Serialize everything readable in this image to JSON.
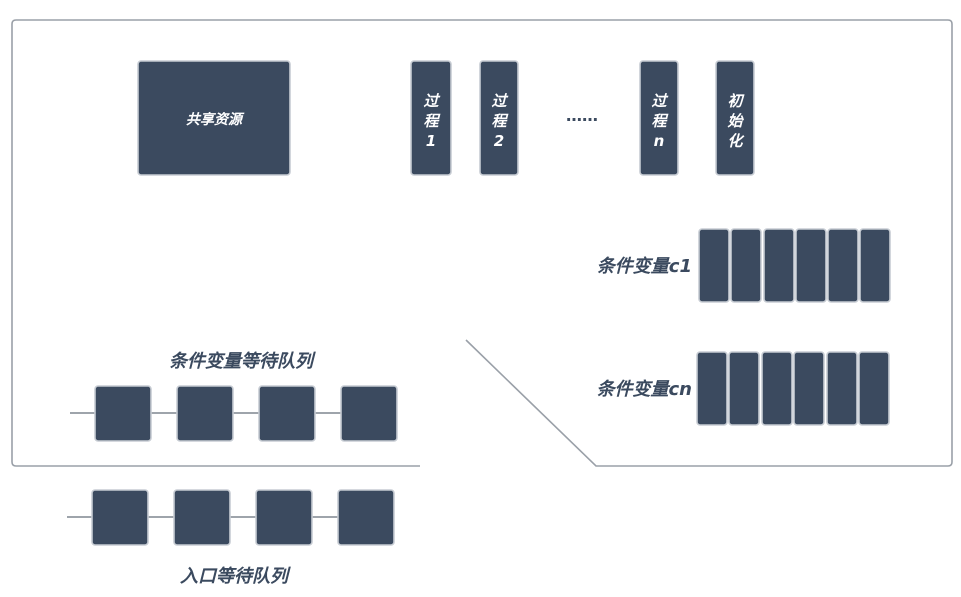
{
  "shared_resource": "共享资源",
  "process_1": [
    "过",
    "程",
    "1"
  ],
  "process_2": [
    "过",
    "程",
    "2"
  ],
  "ellipsis": "……",
  "process_n": [
    "过",
    "程",
    "n"
  ],
  "init": [
    "初",
    "始",
    "化"
  ],
  "cond_var_c1": "条件变量c1",
  "cond_var_cn": "条件变量cn",
  "cond_wait_queue": "条件变量等待队列",
  "entry_wait_queue": "入口等待队列",
  "colors": {
    "box_fill": "#3b4a5f",
    "box_border": "#c7ccd3",
    "frame": "#9aa0a8"
  }
}
